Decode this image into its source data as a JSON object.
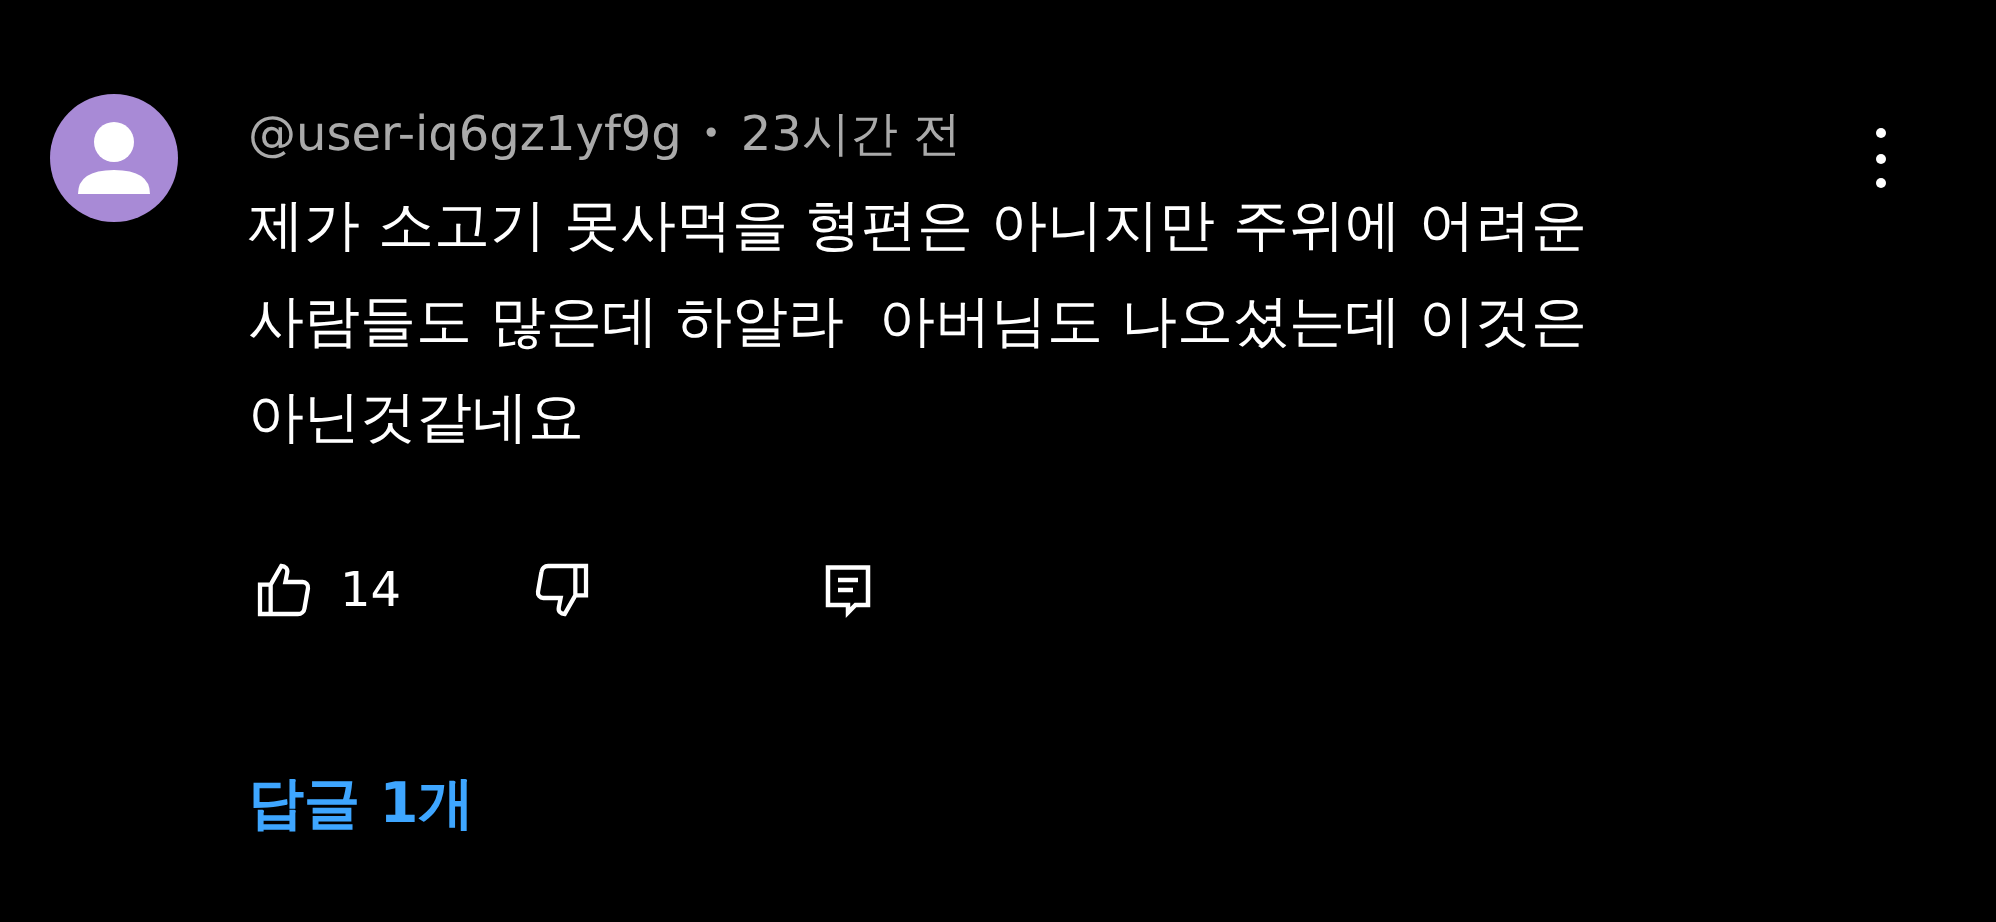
{
  "comment": {
    "author": "@user-iq6gz1yf9g",
    "separator": "•",
    "time": "23시간 전",
    "text": "제가 소고기 못사먹을 형편은 아니지만 주위에 어려운\n사람들도 많은데 하알라  아버님도 나오셨는데 이것은\n아닌것같네요",
    "likes": "14",
    "replies_link": "답글 1개"
  }
}
